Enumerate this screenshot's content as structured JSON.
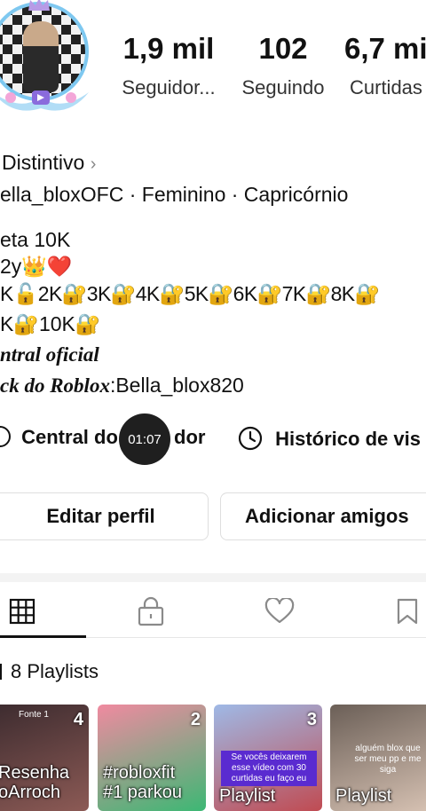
{
  "profile": {
    "stats": [
      {
        "value": "1,9 mil",
        "label": "Seguidor..."
      },
      {
        "value": "102",
        "label": "Seguindo"
      },
      {
        "value": "6,7 mi",
        "label": "Curtidas"
      }
    ],
    "badge_label": "Distintivo",
    "info_line": "ella_bloxOFC · Feminino · Capricórnio",
    "bio": {
      "line1": "eta 10K",
      "line2": "2y👑❤️",
      "line3": "K🔓2K🔐3K🔐4K🔐5K🔐6K🔐7K🔐8K🔐",
      "line4": "K🔐10K🔐",
      "line5": "ntral oficial",
      "line6_bold": "ck do Roblox",
      "line6_rest": ":Bella_blox820"
    },
    "links": {
      "left": "Central do",
      "left_end": "dor",
      "right": "Histórico de vis"
    },
    "video_time": "01:07",
    "buttons": {
      "edit": "Editar perfil",
      "add_friends": "Adicionar amigos"
    }
  },
  "tabs": [
    "grid-icon",
    "lock-icon",
    "heart-icon",
    "bookmark-icon"
  ],
  "playlists": {
    "header": "8 Playlists",
    "items": [
      {
        "count": "4",
        "title1": "Resenha",
        "title2": "oArroch",
        "top_caption": "Fonte 1",
        "caption": "",
        "colors": [
          "#3a2a2e",
          "#8c5a55"
        ]
      },
      {
        "count": "2",
        "title1": "#robloxfit",
        "title2": "#1 parkou",
        "top_caption": "",
        "caption": "",
        "colors": [
          "#f08aa0",
          "#3cb874"
        ]
      },
      {
        "count": "3",
        "title1": "Playlist",
        "title2": "",
        "top_caption": "",
        "caption": "Se vocês deixarem esse vídeo com 30 curtidas eu faço eu",
        "colors": [
          "#9fb9e6",
          "#c04b52"
        ]
      },
      {
        "count": "",
        "title1": "Playlist",
        "title2": "",
        "top_caption": "",
        "caption": "alguém blox que ser meu pp e me siga",
        "colors": [
          "#6b5f57",
          "#d8c3b4"
        ]
      }
    ]
  },
  "colors": {
    "accent_ring": "#7ec8f0",
    "timer_bg": "#1f1f1f"
  }
}
